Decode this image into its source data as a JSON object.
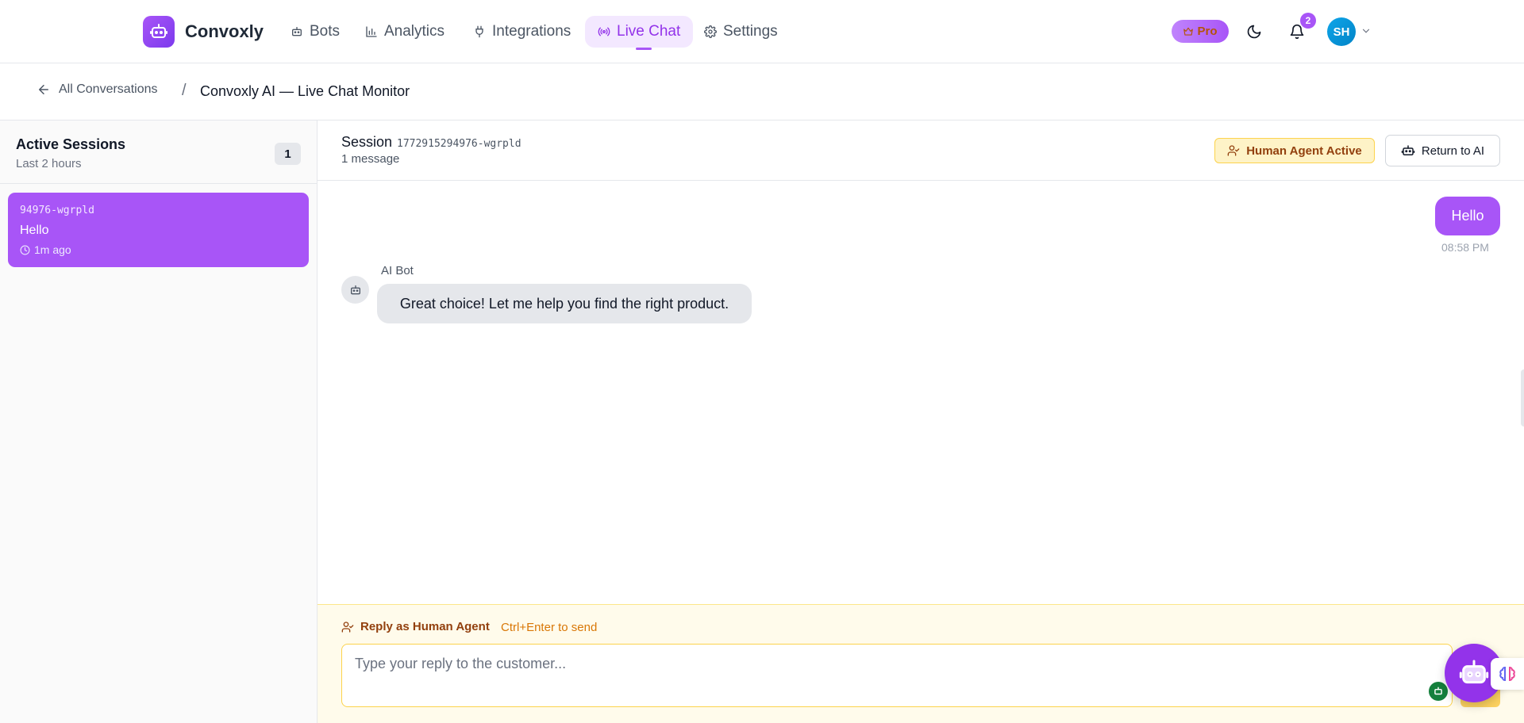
{
  "app": {
    "name": "Convoxly"
  },
  "nav": {
    "items": [
      {
        "label": "Bots",
        "icon": "robot-icon"
      },
      {
        "label": "Analytics",
        "icon": "bar-chart-icon"
      },
      {
        "label": "Integrations",
        "icon": "plug-icon"
      },
      {
        "label": "Live Chat",
        "icon": "broadcast-icon",
        "active": true
      },
      {
        "label": "Settings",
        "icon": "gear-icon"
      }
    ],
    "pro_label": "Pro",
    "notification_count": "2",
    "user_initials": "SH"
  },
  "breadcrumb": {
    "back_label": "All Conversations",
    "separator": "/",
    "title": "Convoxly AI — Live Chat Monitor"
  },
  "sidebar": {
    "title": "Active Sessions",
    "subtitle": "Last 2 hours",
    "count": "1",
    "sessions": [
      {
        "id": "94976-wgrpld",
        "last_message": "Hello",
        "time": "1m ago",
        "selected": true
      }
    ]
  },
  "session": {
    "label": "Session",
    "id": "1772915294976-wgrpld",
    "message_count": "1 message",
    "status_badge": "Human Agent Active",
    "return_button": "Return to AI"
  },
  "messages": [
    {
      "role": "user",
      "text": "Hello",
      "time": "08:58 PM"
    },
    {
      "role": "bot",
      "sender": "AI Bot",
      "text": "Great choice! Let me help you find the right product."
    }
  ],
  "reply": {
    "label": "Reply as Human Agent",
    "hint": "Ctrl+Enter to send",
    "placeholder": "Type your reply to the customer..."
  },
  "colors": {
    "accent": "#a855f7",
    "accent_light": "#f3e8ff",
    "warning_bg": "#fef3c7",
    "warning_text": "#92400e"
  }
}
